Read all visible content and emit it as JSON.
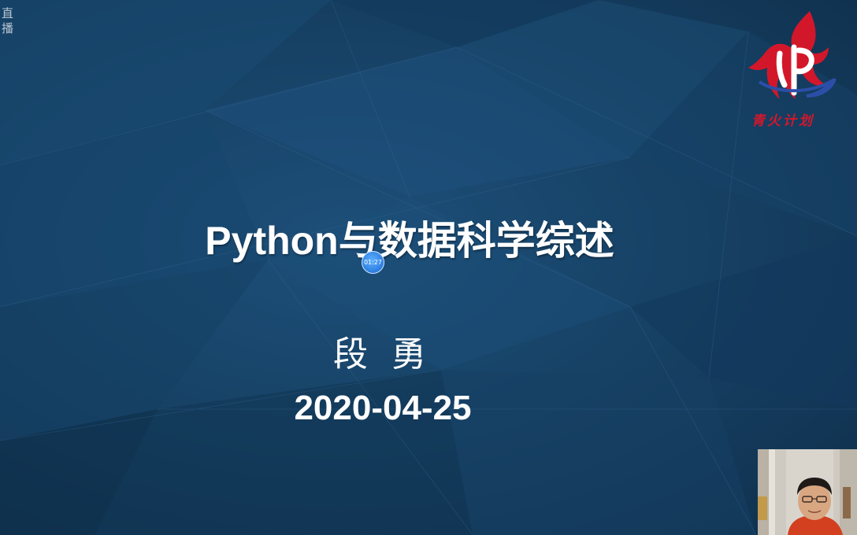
{
  "overlay": {
    "live_label": "直播",
    "timer": "01:27"
  },
  "slide": {
    "title": "Python与数据科学综述",
    "author": "段 勇",
    "date": "2020-04-25",
    "logo_text": "青火计划",
    "background_color": "#174266"
  },
  "webcam": {
    "icon": "webcam-video-feed"
  }
}
